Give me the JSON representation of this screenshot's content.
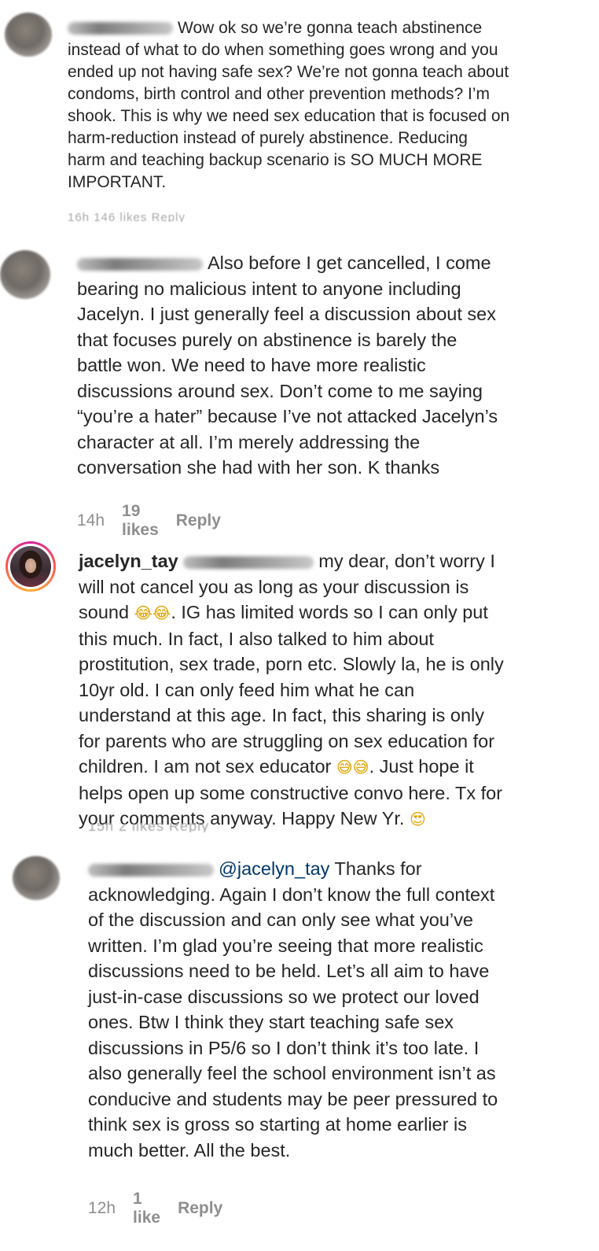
{
  "comments": [
    {
      "text_after_name": "Wow ok so we’re gonna teach abstinence\ninstead of what to do when something goes wrong and you\nended up not having safe sex? We’re not gonna teach about\ncondoms, birth control and other prevention methods? I’m\nshook. This is why we need sex education that is focused on\nharm-reduction instead of purely abstinence. Reducing\nharm and teaching backup scenario is SO MUCH MORE\nIMPORTANT.",
      "meta_faded": "16h   146 likes   Reply"
    },
    {
      "text_after_name": "Also before I get cancelled, I come\nbearing no malicious intent to anyone including\nJacelyn. I just generally feel a discussion about sex\nthat focuses purely on abstinence is barely the\nbattle won. We need to have more realistic\ndiscussions around sex. Don’t come to me saying\n“you’re a hater” because I’ve not attacked Jacelyn’s\ncharacter at all. I’m merely addressing the\nconversation she had with her son. K thanks",
      "time": "14h",
      "likes": "19 likes",
      "reply": "Reply"
    },
    {
      "username": "jacelyn_tay",
      "text_line1_after": "my dear, don’t worry I",
      "text_line2": "will not cancel you as long as your discussion is",
      "text_line3_pre": "sound ",
      "emoji_a": "😂😂",
      "text_line3_post": ". IG has limited words so I can only put",
      "text_rest": "this much. In fact, I also talked to him about\nprostitution, sex trade, porn etc. Slowly la, he is only\n10yr old. I can only feed him what he can\nunderstand at this age. In fact, this sharing is only\nfor parents who are struggling on sex education for",
      "text_line9_pre": "children. I am not sex educator ",
      "emoji_b": "😅😅",
      "text_line9_post": ". Just hope it",
      "text_line10": "helps open up some constructive convo here. Tx for",
      "text_line11_pre": "your comments anyway. Happy New Yr. ",
      "emoji_c": "😍",
      "meta_faded": "15h   2 likes   Reply"
    },
    {
      "mention": "@jacelyn_tay",
      "text_line1_after": " Thanks for",
      "text_rest": "acknowledging. Again I don’t know the full context\nof the discussion and can only see what you’ve\nwritten. I’m glad you’re seeing that more realistic\ndiscussions need to be held. Let’s all aim to have\njust-in-case discussions so we protect our loved\nones. Btw I think they start teaching safe sex\ndiscussions in P5/6 so I don’t think it’s too late. I\nalso generally feel the school environment isn’t as\nconducive and students may be peer pressured to\nthink sex is gross so starting at home earlier is\nmuch better. All the best.",
      "time": "12h",
      "likes": "1 like",
      "reply": "Reply"
    }
  ]
}
